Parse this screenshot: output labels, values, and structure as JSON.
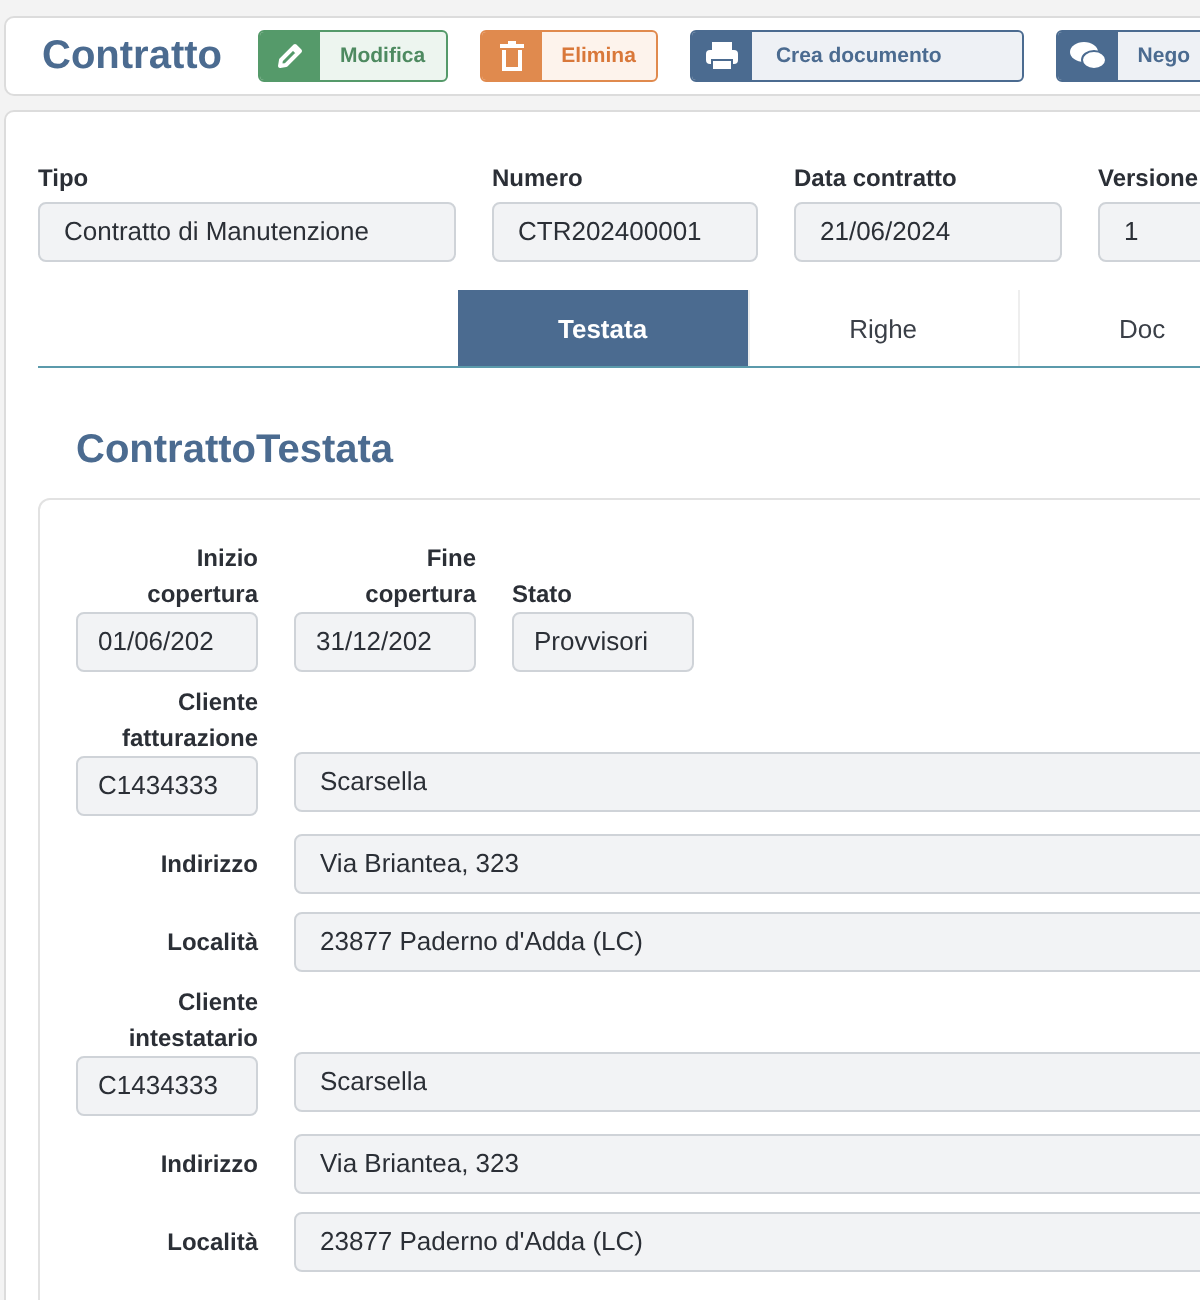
{
  "header": {
    "title": "Contratto",
    "buttons": [
      {
        "label": "Modifica",
        "kind": "edit"
      },
      {
        "label": "Elimina",
        "kind": "delete"
      },
      {
        "label": "Crea documento",
        "kind": "print"
      },
      {
        "label": "Nego",
        "kind": "chat"
      }
    ]
  },
  "fields": [
    {
      "label": "Tipo",
      "value": "Contratto di Manutenzione"
    },
    {
      "label": "Numero",
      "value": "CTR202400001"
    },
    {
      "label": "Data contratto",
      "value": "21/06/2024"
    },
    {
      "label": "Versione",
      "value": "1"
    }
  ],
  "tabs": [
    {
      "label": "Testata",
      "selected": true
    },
    {
      "label": "Righe",
      "selected": false
    },
    {
      "label": "Doc",
      "selected": false
    }
  ],
  "section": {
    "title": "ContrattoTestata",
    "coverage": [
      {
        "label": "Inizio copertura",
        "value": "01/06/202"
      },
      {
        "label": "Fine copertura",
        "value": "31/12/202"
      }
    ],
    "status": {
      "label": "Stato",
      "value": "Provvisori"
    },
    "groups": [
      {
        "label": "Cliente fatturazione",
        "code": "C1434333",
        "name": "Scarsella",
        "rows": [
          {
            "label": "Indirizzo",
            "value": "Via Briantea, 323"
          },
          {
            "label": "Località",
            "value": "23877 Paderno d'Adda (LC)"
          }
        ]
      },
      {
        "label": "Cliente intestatario",
        "code": "C1434333",
        "name": "Scarsella",
        "rows": [
          {
            "label": "Indirizzo",
            "value": "Via Briantea, 323"
          },
          {
            "label": "Località",
            "value": "23877 Paderno d'Adda (LC)"
          }
        ]
      }
    ]
  }
}
